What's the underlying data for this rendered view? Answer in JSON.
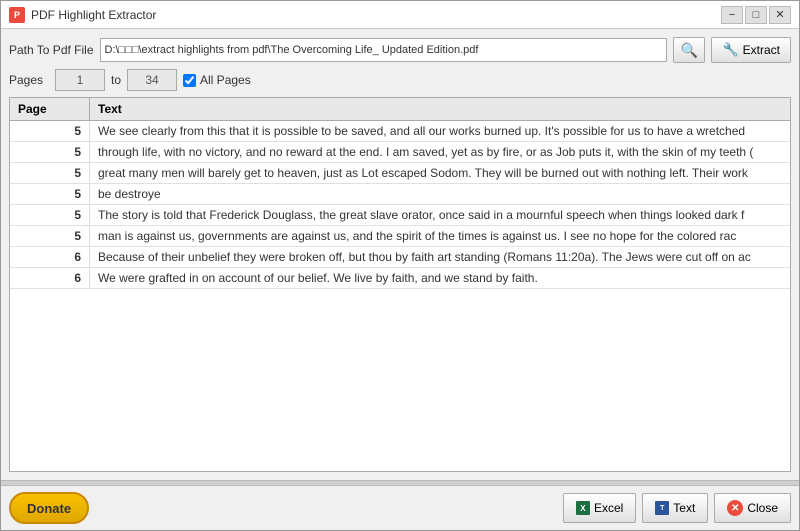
{
  "window": {
    "title": "PDF Highlight Extractor",
    "min_label": "−",
    "max_label": "□",
    "close_label": "✕"
  },
  "path_row": {
    "label": "Path To Pdf File",
    "value": "D:\\□□□\\extract highlights from pdf\\The Overcoming Life_ Updated Edition.pdf",
    "browse_label": "🔍",
    "extract_label": "Extract"
  },
  "pages_row": {
    "label": "Pages",
    "from": "1",
    "to": "34",
    "all_pages_label": "All Pages",
    "all_pages_checked": true
  },
  "table": {
    "col_page": "Page",
    "col_text": "Text",
    "rows": [
      {
        "page": "5",
        "text": "We see clearly from this that it is possible to be saved, and all our works burned up. It's possible for us to have a wretched"
      },
      {
        "page": "5",
        "text": "through life, with no victory, and no reward at the end. I am saved, yet as by fire, or as Job puts it, with the skin of my teeth ("
      },
      {
        "page": "5",
        "text": "great many men will barely get to heaven, just as Lot escaped Sodom. They will be burned out with nothing left. Their work"
      },
      {
        "page": "5",
        "text": "be destroye"
      },
      {
        "page": "5",
        "text": "The story is told that Frederick Douglass, the great slave orator, once said in a mournful speech when things looked dark f"
      },
      {
        "page": "5",
        "text": "man is against us, governments are against us, and the spirit of the times is against us. I see no hope for the colored rac"
      },
      {
        "page": "6",
        "text": "Because of their unbelief they were broken off, but thou by faith art standing (Romans 11:20a). The Jews were cut off on ac"
      },
      {
        "page": "6",
        "text": "We were grafted in on account of our belief. We live by faith, and we stand by faith."
      }
    ]
  },
  "bottom": {
    "donate_label": "Donate",
    "excel_label": "Excel",
    "text_label": "Text",
    "close_label": "Close"
  }
}
